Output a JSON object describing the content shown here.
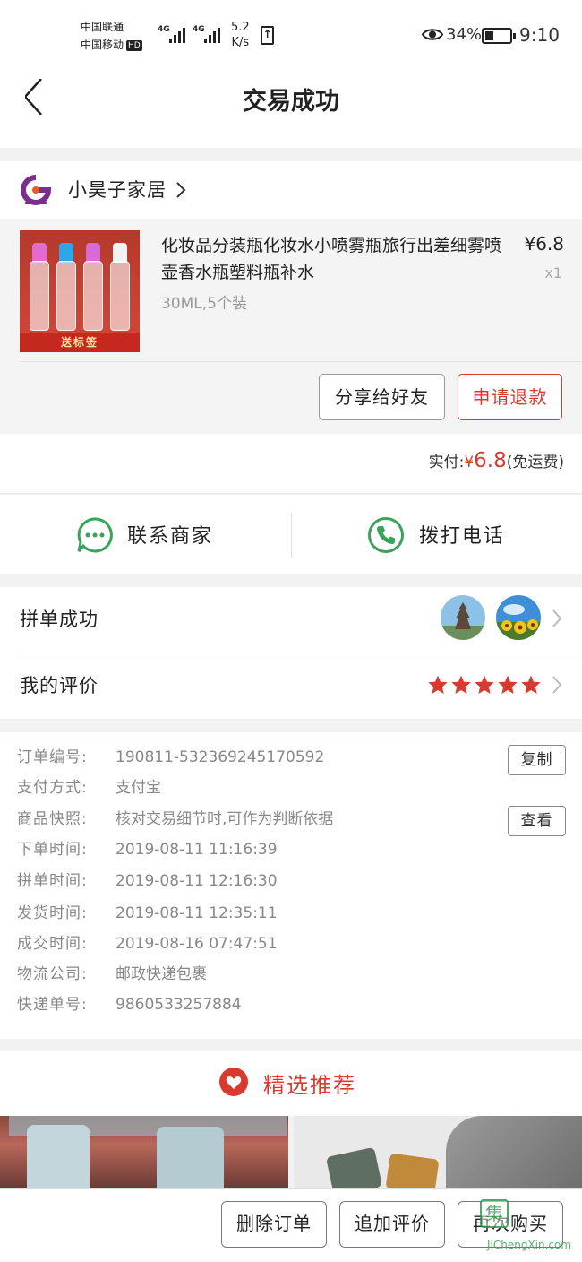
{
  "status_bar": {
    "carrier_1": "中国联通",
    "carrier_2": "中国移动",
    "hd": "HD",
    "net_1": "4G",
    "net_2": "4G",
    "speed_value": "5.2",
    "speed_unit": "K/s",
    "battery_pct": "34%",
    "battery_level": 0.34,
    "time": "9:10",
    "icons": [
      "signal-bars-icon",
      "upload-icon",
      "eye-icon",
      "battery-icon"
    ]
  },
  "header": {
    "title": "交易成功",
    "back_icon": "chevron-left-icon"
  },
  "shop": {
    "name": "小昊子家居",
    "logo_icon": "shop-logo-icon"
  },
  "product": {
    "name": "化妆品分装瓶化妆水小喷雾瓶旅行出差细雾喷壶香水瓶塑料瓶补水",
    "spec": "30ML,5个装",
    "price": "¥6.8",
    "quantity": "x1",
    "thumb_tag": "送标签",
    "share_label": "分享给好友",
    "refund_label": "申请退款"
  },
  "payment": {
    "label": "实付:",
    "currency": "¥",
    "amount": "6.8",
    "shipping": "(免运费)"
  },
  "contact": {
    "merchant_label": "联系商家",
    "phone_label": "拨打电话"
  },
  "group": {
    "label": "拼单成功"
  },
  "review": {
    "label": "我的评价",
    "stars": 5
  },
  "order_info": {
    "rows": [
      {
        "key": "订单编号:",
        "value": "190811-532369245170592"
      },
      {
        "key": "支付方式:",
        "value": "支付宝"
      },
      {
        "key": "商品快照:",
        "value": "核对交易细节时,可作为判断依据"
      },
      {
        "key": "下单时间:",
        "value": "2019-08-11 11:16:39"
      },
      {
        "key": "拼单时间:",
        "value": "2019-08-11 12:16:30"
      },
      {
        "key": "发货时间:",
        "value": "2019-08-11 12:35:11"
      },
      {
        "key": "成交时间:",
        "value": "2019-08-16 07:47:51"
      },
      {
        "key": "物流公司:",
        "value": "邮政快递包裹"
      },
      {
        "key": "快递单号:",
        "value": "9860533257884"
      }
    ],
    "copy_label": "复制",
    "view_label": "查看"
  },
  "recommend": {
    "label": "精选推荐"
  },
  "bottom_bar": {
    "delete_label": "删除订单",
    "add_review_label": "追加评价",
    "buy_again_label": "再次购买"
  },
  "watermark": {
    "text": "JiChengXin.com"
  },
  "colors": {
    "accent": "#d93a2f",
    "green": "#3aa35a",
    "muted": "#888888",
    "star": "#d93a2f"
  }
}
